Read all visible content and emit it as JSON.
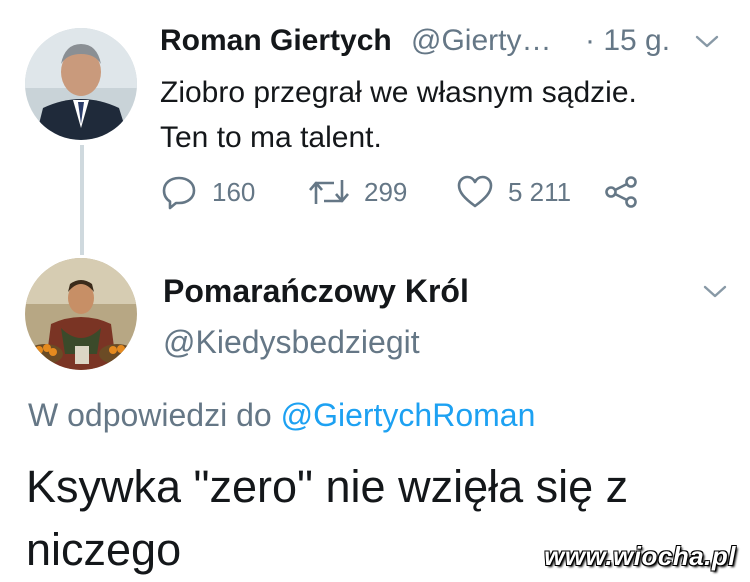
{
  "tweet1": {
    "author_name": "Roman Giertych",
    "author_handle": "@Gierty…",
    "time": "· 15 g.",
    "text_lines": [
      "Ziobro przegrał we własnym sądzie.",
      "Ten to ma talent."
    ],
    "actions": {
      "replies": "160",
      "retweets": "299",
      "likes": "5 211"
    }
  },
  "tweet2": {
    "author_name": "Pomarańczowy Król",
    "author_handle": "@Kiedysbedziegit",
    "reply_prefix": "W odpowiedzi do",
    "reply_mention": "@GiertychRoman",
    "text_lines": [
      "Ksywka \"zero\" nie wzięła się z",
      "niczego"
    ]
  },
  "watermark": "www.wiocha.pl",
  "colors": {
    "text": "#14171a",
    "secondary": "#657786",
    "link": "#1da1f2",
    "thread_line": "#cfd9de"
  },
  "icons": [
    "reply-icon",
    "retweet-icon",
    "like-icon",
    "share-icon",
    "chevron-down-icon"
  ]
}
